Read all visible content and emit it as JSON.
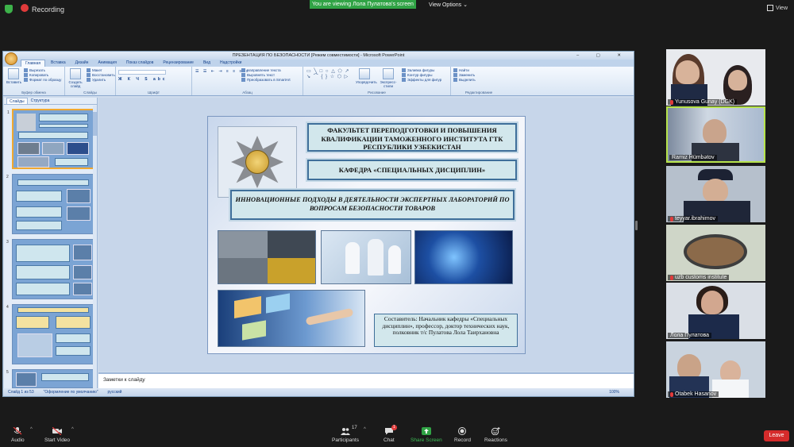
{
  "zoom_topbar": {
    "recording_label": "Recording",
    "viewing_banner": "You are viewing Лола Пулатова's screen",
    "view_options": "View Options",
    "view_mode": "View"
  },
  "ppt": {
    "window_title": "ПРЕЗЕНТАЦИЯ ПО БЕЗОПАСНОСТИ [Режим совместимости] - Microsoft PowerPoint",
    "tabs": [
      "Главная",
      "Вставка",
      "Дизайн",
      "Анимация",
      "Показ слайдов",
      "Рецензирование",
      "Вид",
      "Надстройки"
    ],
    "ribbon_groups": {
      "clipboard": {
        "label": "Буфер обмена",
        "paste": "Вставить",
        "cut": "Вырезать",
        "copy": "Копировать",
        "format": "Формат по образцу"
      },
      "slides": {
        "label": "Слайды",
        "create": "Создать слайд",
        "layout": "Макет",
        "reset": "Восстановить",
        "delete": "Удалить"
      },
      "font": {
        "label": "Шрифт"
      },
      "paragraph": {
        "label": "Абзац",
        "direction": "Направление текста",
        "align": "Выровнять текст",
        "smartart": "Преобразовать в SmartArt"
      },
      "drawing": {
        "label": "Рисование",
        "arrange": "Упорядочить",
        "styles": "Экспресс-стили",
        "fill": "Заливка фигуры",
        "outline": "Контур фигуры",
        "effects": "Эффекты для фигур"
      },
      "editing": {
        "label": "Редактирование",
        "find": "Найти",
        "replace": "Заменить",
        "select": "Выделить"
      }
    },
    "pane_tabs": [
      "Слайды",
      "Структура"
    ],
    "slide_numbers": [
      "1",
      "2",
      "3",
      "4",
      "5"
    ],
    "slide": {
      "header_title": "ФАКУЛЬТЕТ ПЕРЕПОДГОТОВКИ И ПОВЫШЕНИЯ КВАЛИФИКАЦИИ ТАМОЖЕННОГО ИНСТИТУТА ГТК РЕСПУБЛИКИ УЗБЕКИСТАН",
      "department": "КАФЕДРА «СПЕЦИАЛЬНЫХ ДИСЦИПЛИН»",
      "topic": "ИННОВАЦИОННЫЕ ПОДХОДЫ В ДЕЯТЕЛЬНОСТИ ЭКСПЕРТНЫХ ЛАБОРАТОРИЙ ПО ВОПРОСАМ БЕЗОПАСНОСТИ ТОВАРОВ",
      "author": "Составитель: Начальник кафедры «Специальных дисциплин», профессор, доктор технических наук, полковник т/с Пулатова Лола Таирхановна"
    },
    "notes_placeholder": "Заметки к слайду",
    "status": {
      "slide_counter": "Слайд 1 из 53",
      "theme": "\"Оформление по умолчанию\"",
      "language": "русский",
      "zoom": "100%"
    }
  },
  "participants_tiles": [
    {
      "name": "Yunusova Gunay (DGK)",
      "muted": true
    },
    {
      "name": "Ramiz Hümbətov",
      "muted": false,
      "speaking": true
    },
    {
      "name": "teyyar.ibrahimov",
      "muted": true
    },
    {
      "name": "uzb customs institute",
      "muted": true
    },
    {
      "name": "Лола Пулатова",
      "muted": false
    },
    {
      "name": "Otabek Hasanov",
      "muted": true
    }
  ],
  "toolbar": {
    "audio": "Audio",
    "video": "Start Video",
    "participants": "Participants",
    "participants_count": "17",
    "chat": "Chat",
    "chat_badge": "1",
    "share": "Share Screen",
    "record": "Record",
    "reactions": "Reactions",
    "leave": "Leave"
  },
  "colors": {
    "accent_green": "#30a345",
    "leave_red": "#d52b2b",
    "speaker_border": "#b6e34b"
  }
}
